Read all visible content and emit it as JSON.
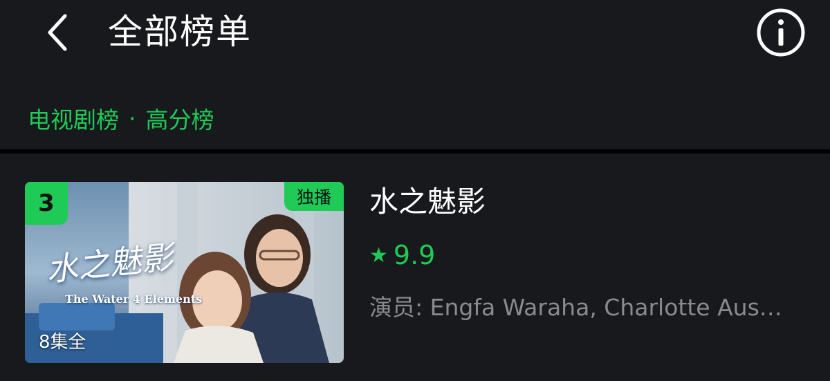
{
  "header": {
    "title": "全部榜单",
    "back_icon": "chevron-left-icon",
    "info_icon": "info-icon"
  },
  "crumbs": {
    "category": "电视剧榜",
    "separator": "·",
    "ranking": "高分榜"
  },
  "colors": {
    "accent": "#1fcb56",
    "background": "#18191d",
    "muted_text": "#8a8b8f"
  },
  "item": {
    "rank": "3",
    "exclusive_label": "独播",
    "episodes_label": "8集全",
    "poster_title_cn": "水之魅影",
    "poster_title_en": "The Water 4 Elements",
    "title": "水之魅影",
    "rating_icon": "star-icon",
    "rating": "9.9",
    "cast": "演员: Engfa Waraha, Charlotte Aus…"
  }
}
